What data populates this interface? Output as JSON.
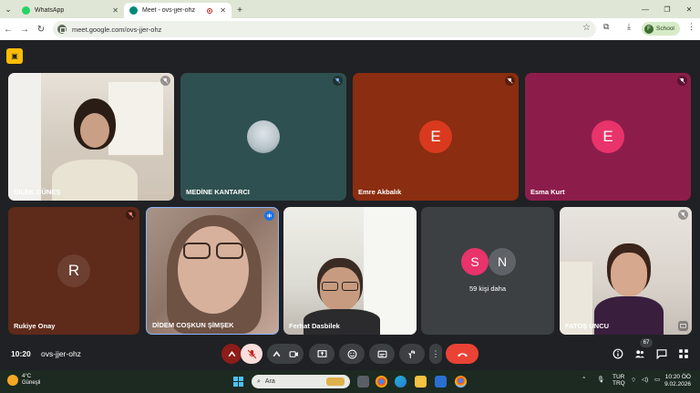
{
  "browser": {
    "tabs": [
      {
        "title": "WhatsApp",
        "favicon_color": "#25d366"
      },
      {
        "title": "Meet - ovs-jjer-ohz",
        "favicon_color": "#00897b"
      }
    ],
    "url": "meet.google.com/ovs-jjer-ohz",
    "profile_initial": "F",
    "profile_label": "School"
  },
  "meet": {
    "participants_row1": [
      {
        "name": "DİLEK GÜNEŞ",
        "type": "video",
        "muted": true
      },
      {
        "name": "MEDİNE KANTARCI",
        "type": "image",
        "muted": true
      },
      {
        "name": "Emre Akbalık",
        "type": "avatar",
        "initial": "E",
        "tile_color": "#8a2d10",
        "avatar_color": "#d93a1f",
        "muted": true
      },
      {
        "name": "Esma Kurt",
        "type": "avatar",
        "initial": "E",
        "tile_color": "#8c1d4a",
        "avatar_color": "#e8336b",
        "muted": true
      }
    ],
    "participants_row2": [
      {
        "name": "Rukiye Onay",
        "type": "avatar",
        "initial": "R",
        "tile_color": "#5e2a1a",
        "avatar_color": "#6d3f30",
        "muted": true
      },
      {
        "name": "DİDEM COŞKUN ŞİMŞEK",
        "type": "video",
        "speaking": true
      },
      {
        "name": "Ferhat Dasbilek",
        "type": "video"
      },
      {
        "more_initials": [
          "S",
          "N"
        ],
        "more_label": "59 kişi daha"
      },
      {
        "name": "FATOŞ UNCU",
        "type": "video",
        "muted": true
      }
    ],
    "time": "10:20",
    "code": "ovs-jjer-ohz",
    "people_count": "67"
  },
  "taskbar": {
    "temp": "4°C",
    "weather": "Güneşli",
    "search_placeholder": "Ara",
    "lang1": "TUR",
    "lang2": "TRQ",
    "clock_time": "10:20",
    "clock_suffix": "ÖÖ",
    "clock_date": "9.02.2026"
  }
}
